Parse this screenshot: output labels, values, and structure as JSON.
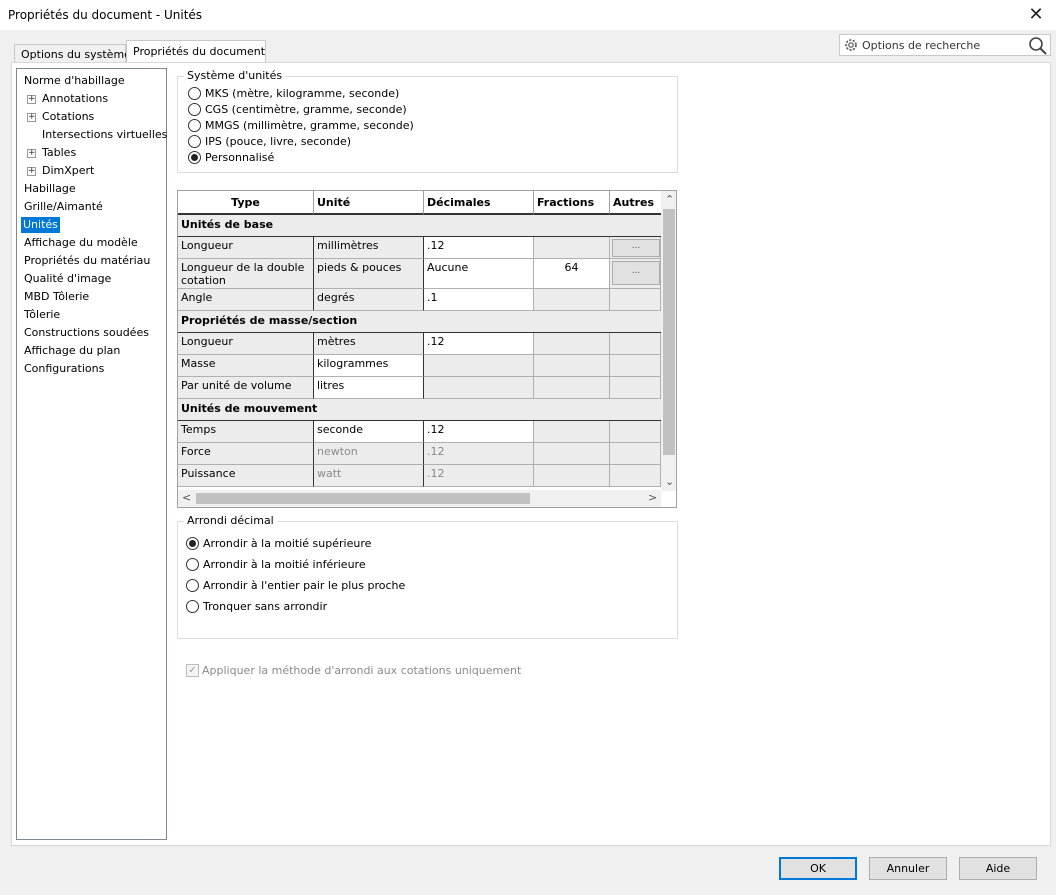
{
  "window": {
    "title": "Propriétés du document - Unités"
  },
  "tabs": [
    {
      "label": "Options du système"
    },
    {
      "label": "Propriétés du document"
    }
  ],
  "search": {
    "placeholder": "Options de recherche"
  },
  "tree": [
    {
      "label": "Norme d'habillage"
    },
    {
      "label": "Annotations"
    },
    {
      "label": "Cotations"
    },
    {
      "label": "Intersections virtuelles"
    },
    {
      "label": "Tables"
    },
    {
      "label": "DimXpert"
    },
    {
      "label": "Habillage"
    },
    {
      "label": "Grille/Aimanté"
    },
    {
      "label": "Unités"
    },
    {
      "label": "Affichage du modèle"
    },
    {
      "label": "Propriétés du matériau"
    },
    {
      "label": "Qualité d'image"
    },
    {
      "label": "MBD Tôlerie"
    },
    {
      "label": "Tôlerie"
    },
    {
      "label": "Constructions soudées"
    },
    {
      "label": "Affichage du plan"
    },
    {
      "label": "Configurations"
    }
  ],
  "unit_system": {
    "title": "Système d'unités",
    "options": [
      {
        "label": "MKS (mètre, kilogramme, seconde)"
      },
      {
        "label": "CGS (centimètre, gramme, seconde)"
      },
      {
        "label": "MMGS (millimètre, gramme, seconde)"
      },
      {
        "label": "IPS (pouce, livre, seconde)"
      },
      {
        "label": "Personnalisé"
      }
    ]
  },
  "grid": {
    "headers": [
      "Type",
      "Unité",
      "Décimales",
      "Fractions",
      "Autres"
    ],
    "sections": [
      {
        "title": "Unités de base"
      },
      {
        "title": "Propriétés de masse/section"
      },
      {
        "title": "Unités de mouvement"
      }
    ],
    "rows": [
      {
        "type": "Longueur",
        "unit": "millimètres",
        "decimals": ".12",
        "fractions": "",
        "other": "..."
      },
      {
        "type": "Longueur de la double cotation",
        "unit": "pieds & pouces",
        "decimals": "Aucune",
        "fractions": "64",
        "other": "..."
      },
      {
        "type": "Angle",
        "unit": "degrés",
        "decimals": ".1",
        "fractions": "",
        "other": ""
      },
      {
        "type": "Longueur",
        "unit": "mètres",
        "decimals": ".12",
        "fractions": "",
        "other": ""
      },
      {
        "type": "Masse",
        "unit": "kilogrammes",
        "decimals": "",
        "fractions": "",
        "other": ""
      },
      {
        "type": "Par unité de volume",
        "unit": "litres",
        "decimals": "",
        "fractions": "",
        "other": ""
      },
      {
        "type": "Temps",
        "unit": "seconde",
        "decimals": ".12",
        "fractions": "",
        "other": ""
      },
      {
        "type": "Force",
        "unit": "newton",
        "decimals": ".12",
        "fractions": "",
        "other": ""
      },
      {
        "type": "Puissance",
        "unit": "watt",
        "decimals": ".12",
        "fractions": "",
        "other": ""
      }
    ]
  },
  "rounding": {
    "title": "Arrondi décimal",
    "options": [
      {
        "label": "Arrondir à la moitié supérieure"
      },
      {
        "label": "Arrondir à la moitié inférieure"
      },
      {
        "label": "Arrondir à l'entier pair le plus proche"
      },
      {
        "label": "Tronquer sans arrondir"
      }
    ]
  },
  "apply_checkbox": {
    "label": "Appliquer la méthode d'arrondi aux cotations uniquement",
    "mark": "✓"
  },
  "buttons": {
    "ok": "OK",
    "cancel": "Annuler",
    "help": "Aide"
  }
}
